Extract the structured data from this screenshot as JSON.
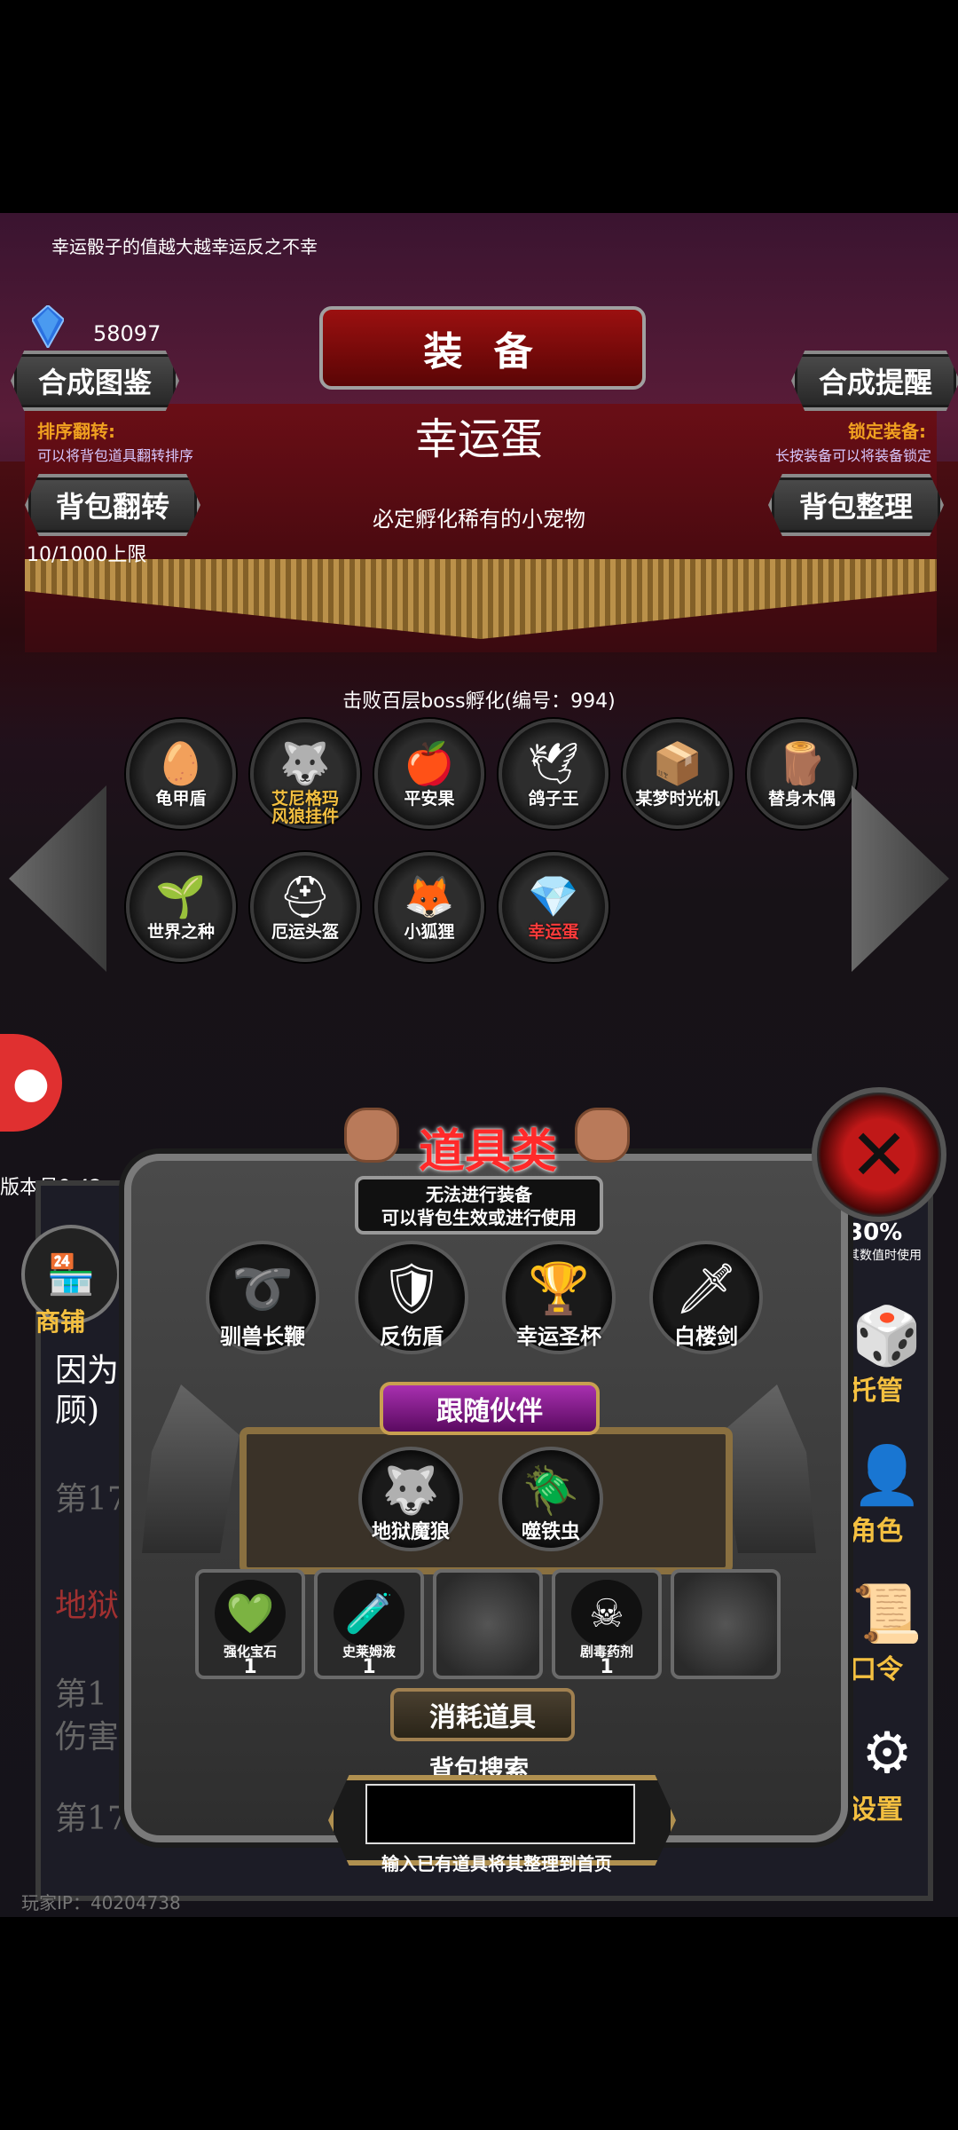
{
  "top_tip": "幸运骰子的值越大越幸运反之不幸",
  "currency": {
    "icon": "blue-gem-icon",
    "amount": "58097"
  },
  "header": {
    "title": "装 备"
  },
  "buttons": {
    "collection": "合成图鉴",
    "remind": "合成提醒",
    "flip": "背包翻转",
    "sort": "背包整理"
  },
  "sort_hint": {
    "label": "排序翻转:",
    "desc": "可以将背包道具翻转排序"
  },
  "lock_hint": {
    "label": "锁定装备:",
    "desc": "长按装备可以将装备锁定"
  },
  "selected_item": {
    "name": "幸运蛋",
    "desc": "必定孵化稀有的小宠物",
    "source": "击败百层boss孵化(编号：994)"
  },
  "capacity": "10/1000上限",
  "pets": [
    {
      "label": "龟甲盾",
      "icon": "🥚",
      "style": ""
    },
    {
      "label": "艾尼格玛\n风狼挂件",
      "icon": "🐺",
      "style": "gold"
    },
    {
      "label": "平安果",
      "icon": "🍎",
      "style": ""
    },
    {
      "label": "鸽子王",
      "icon": "🕊",
      "style": ""
    },
    {
      "label": "某梦时光机",
      "icon": "📦",
      "style": ""
    },
    {
      "label": "替身木偶",
      "icon": "🪵",
      "style": ""
    },
    {
      "label": "世界之种",
      "icon": "🌱",
      "style": ""
    },
    {
      "label": "厄运头盔",
      "icon": "⛑",
      "style": ""
    },
    {
      "label": "小狐狸",
      "icon": "🦊",
      "style": ""
    },
    {
      "label": "幸运蛋",
      "icon": "💎",
      "style": "red"
    }
  ],
  "version": "版本号9.42",
  "side_left": {
    "shop_label": "商铺"
  },
  "side_right": {
    "partial_value": "30%",
    "partial_note": "其数值时使用",
    "items": [
      {
        "label": "托管",
        "icon": "🎲"
      },
      {
        "label": "角色",
        "icon": "👤"
      },
      {
        "label": "口令",
        "icon": "📜"
      },
      {
        "label": "设置",
        "icon": "⚙"
      }
    ]
  },
  "log_lines": [
    "因为",
    "顾)",
    "第17",
    "地狱",
    "第1",
    "伤害",
    "第176回:发现游荡"
  ],
  "player_ip": "玩家IP：40204738",
  "popup": {
    "title": "道具类",
    "note_line1": "无法进行装备",
    "note_line2": "可以背包生效或进行使用",
    "tools": [
      {
        "label": "驯兽长鞭",
        "icon": "➰"
      },
      {
        "label": "反伤盾",
        "icon": "🛡"
      },
      {
        "label": "幸运圣杯",
        "icon": "🏆"
      },
      {
        "label": "白楼剑",
        "icon": "🗡"
      }
    ],
    "companion_title": "跟随伙伴",
    "companions": [
      {
        "label": "地狱魔狼",
        "icon": "🐺"
      },
      {
        "label": "噬铁虫",
        "icon": "🪲"
      }
    ],
    "consumables": [
      {
        "label": "强化宝石",
        "icon": "💚",
        "count": "1",
        "empty": false
      },
      {
        "label": "史莱姆液",
        "icon": "🧪",
        "count": "1",
        "empty": false
      },
      {
        "label": "",
        "icon": "",
        "count": "",
        "empty": true
      },
      {
        "label": "剧毒药剂",
        "icon": "☠",
        "count": "1",
        "empty": false
      },
      {
        "label": "",
        "icon": "",
        "count": "",
        "empty": true
      }
    ],
    "consume_title": "消耗道具",
    "search_title": "背包搜索",
    "search_value": "",
    "search_hint": "输入已有道具将其整理到首页"
  }
}
